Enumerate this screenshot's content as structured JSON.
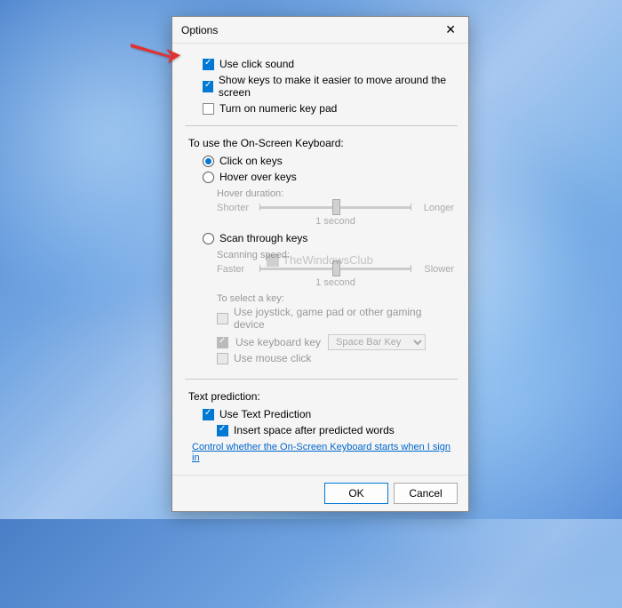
{
  "dialog": {
    "title": "Options"
  },
  "top_checks": {
    "click_sound": "Use click sound",
    "show_keys": "Show keys to make it easier to move around the screen",
    "numeric": "Turn on numeric key pad"
  },
  "keyboard_section": {
    "heading": "To use the On-Screen Keyboard:",
    "click_keys": "Click on keys",
    "hover_keys": "Hover over keys",
    "scan_keys": "Scan through keys"
  },
  "hover": {
    "duration_label": "Hover duration:",
    "min": "Shorter",
    "max": "Longer",
    "value": "1 second"
  },
  "scan": {
    "speed_label": "Scanning speed:",
    "min": "Faster",
    "max": "Slower",
    "value": "1 second",
    "select_label": "To select a key:",
    "joystick": "Use joystick, game pad or other gaming device",
    "keyboard": "Use keyboard key",
    "keyboard_key": "Space Bar Key",
    "mouse": "Use mouse click"
  },
  "text_prediction": {
    "heading": "Text prediction:",
    "use": "Use Text Prediction",
    "insert_space": "Insert space after predicted words"
  },
  "link": "Control whether the On-Screen Keyboard starts when I sign in",
  "buttons": {
    "ok": "OK",
    "cancel": "Cancel"
  },
  "watermark": "TheWindowsClub"
}
